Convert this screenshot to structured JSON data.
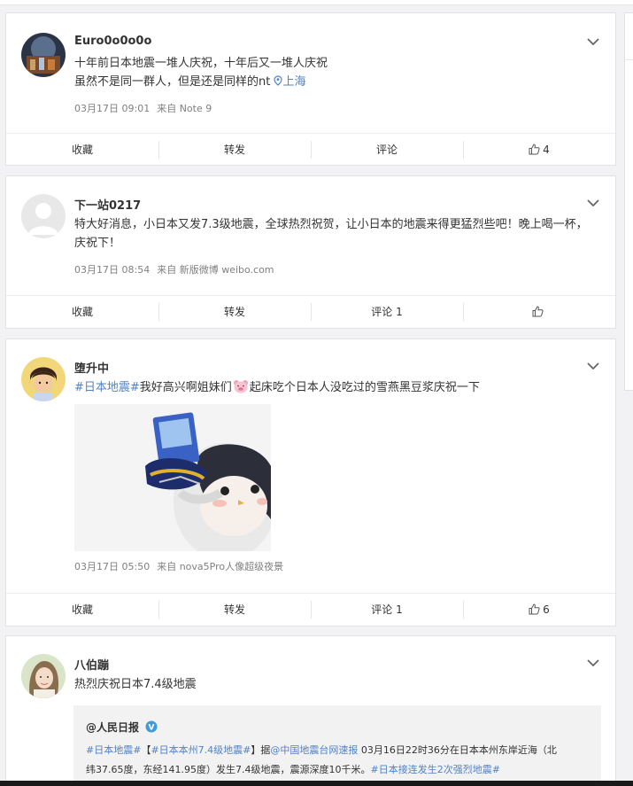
{
  "posts": [
    {
      "username": "Euro0o0o0o",
      "text_lines": [
        "十年前日本地震一堆人庆祝，十年后又一堆人庆祝",
        "虽然不是同一群人，但是还是同样的nt"
      ],
      "location_icon": "location-pin-icon",
      "location": "上海",
      "time": "03月17日 09:01",
      "source": "来自 Note 9",
      "actions": {
        "favorite": "收藏",
        "repost": "转发",
        "comment": "评论",
        "like": "4"
      }
    },
    {
      "username": "下一站0217",
      "text": "特大好消息，小日本又发7.3级地震，全球热烈祝贺，让小日本的地震来得更猛烈些吧！晚上喝一杯，庆祝下！",
      "time": "03月17日 08:54",
      "source": "来自 新版微博 weibo.com",
      "actions": {
        "favorite": "收藏",
        "repost": "转发",
        "comment": "评论 1",
        "like": ""
      }
    },
    {
      "username": "堕升中",
      "topic": "#日本地震#",
      "text_a": "我好高兴啊姐妹们",
      "emoji": "pig-face-emoji",
      "text_b": "起床吃个日本人没吃过的雪燕黑豆浆庆祝一下",
      "image": "penguin-meme-image",
      "time": "03月17日 05:50",
      "source": "来自 nova5Pro人像超级夜景",
      "actions": {
        "favorite": "收藏",
        "repost": "转发",
        "comment": "评论 1",
        "like": "6"
      }
    },
    {
      "username": "八伯蹦",
      "text": "热烈庆祝日本7.4级地震",
      "repost": {
        "author": "@人民日报",
        "verified_icon": "verified-badge-icon",
        "topic1": "#日本地震#",
        "bracket_open": "【",
        "topic2": "#日本本州7.4级地震#",
        "bracket_close": "】",
        "ju": "据",
        "mention": "@中国地震台网速报",
        "body1": " 03月16日22时36分在日本本州东岸近海（北",
        "body2": "纬37.65度，东经141.95度）发生7.4级地震，震源深度10千米。",
        "topic3": "#日本接连发生2次强烈地震#"
      }
    }
  ],
  "colors": {
    "accent": "#eb7350",
    "topic": "#5182c5",
    "meta": "#808080"
  }
}
